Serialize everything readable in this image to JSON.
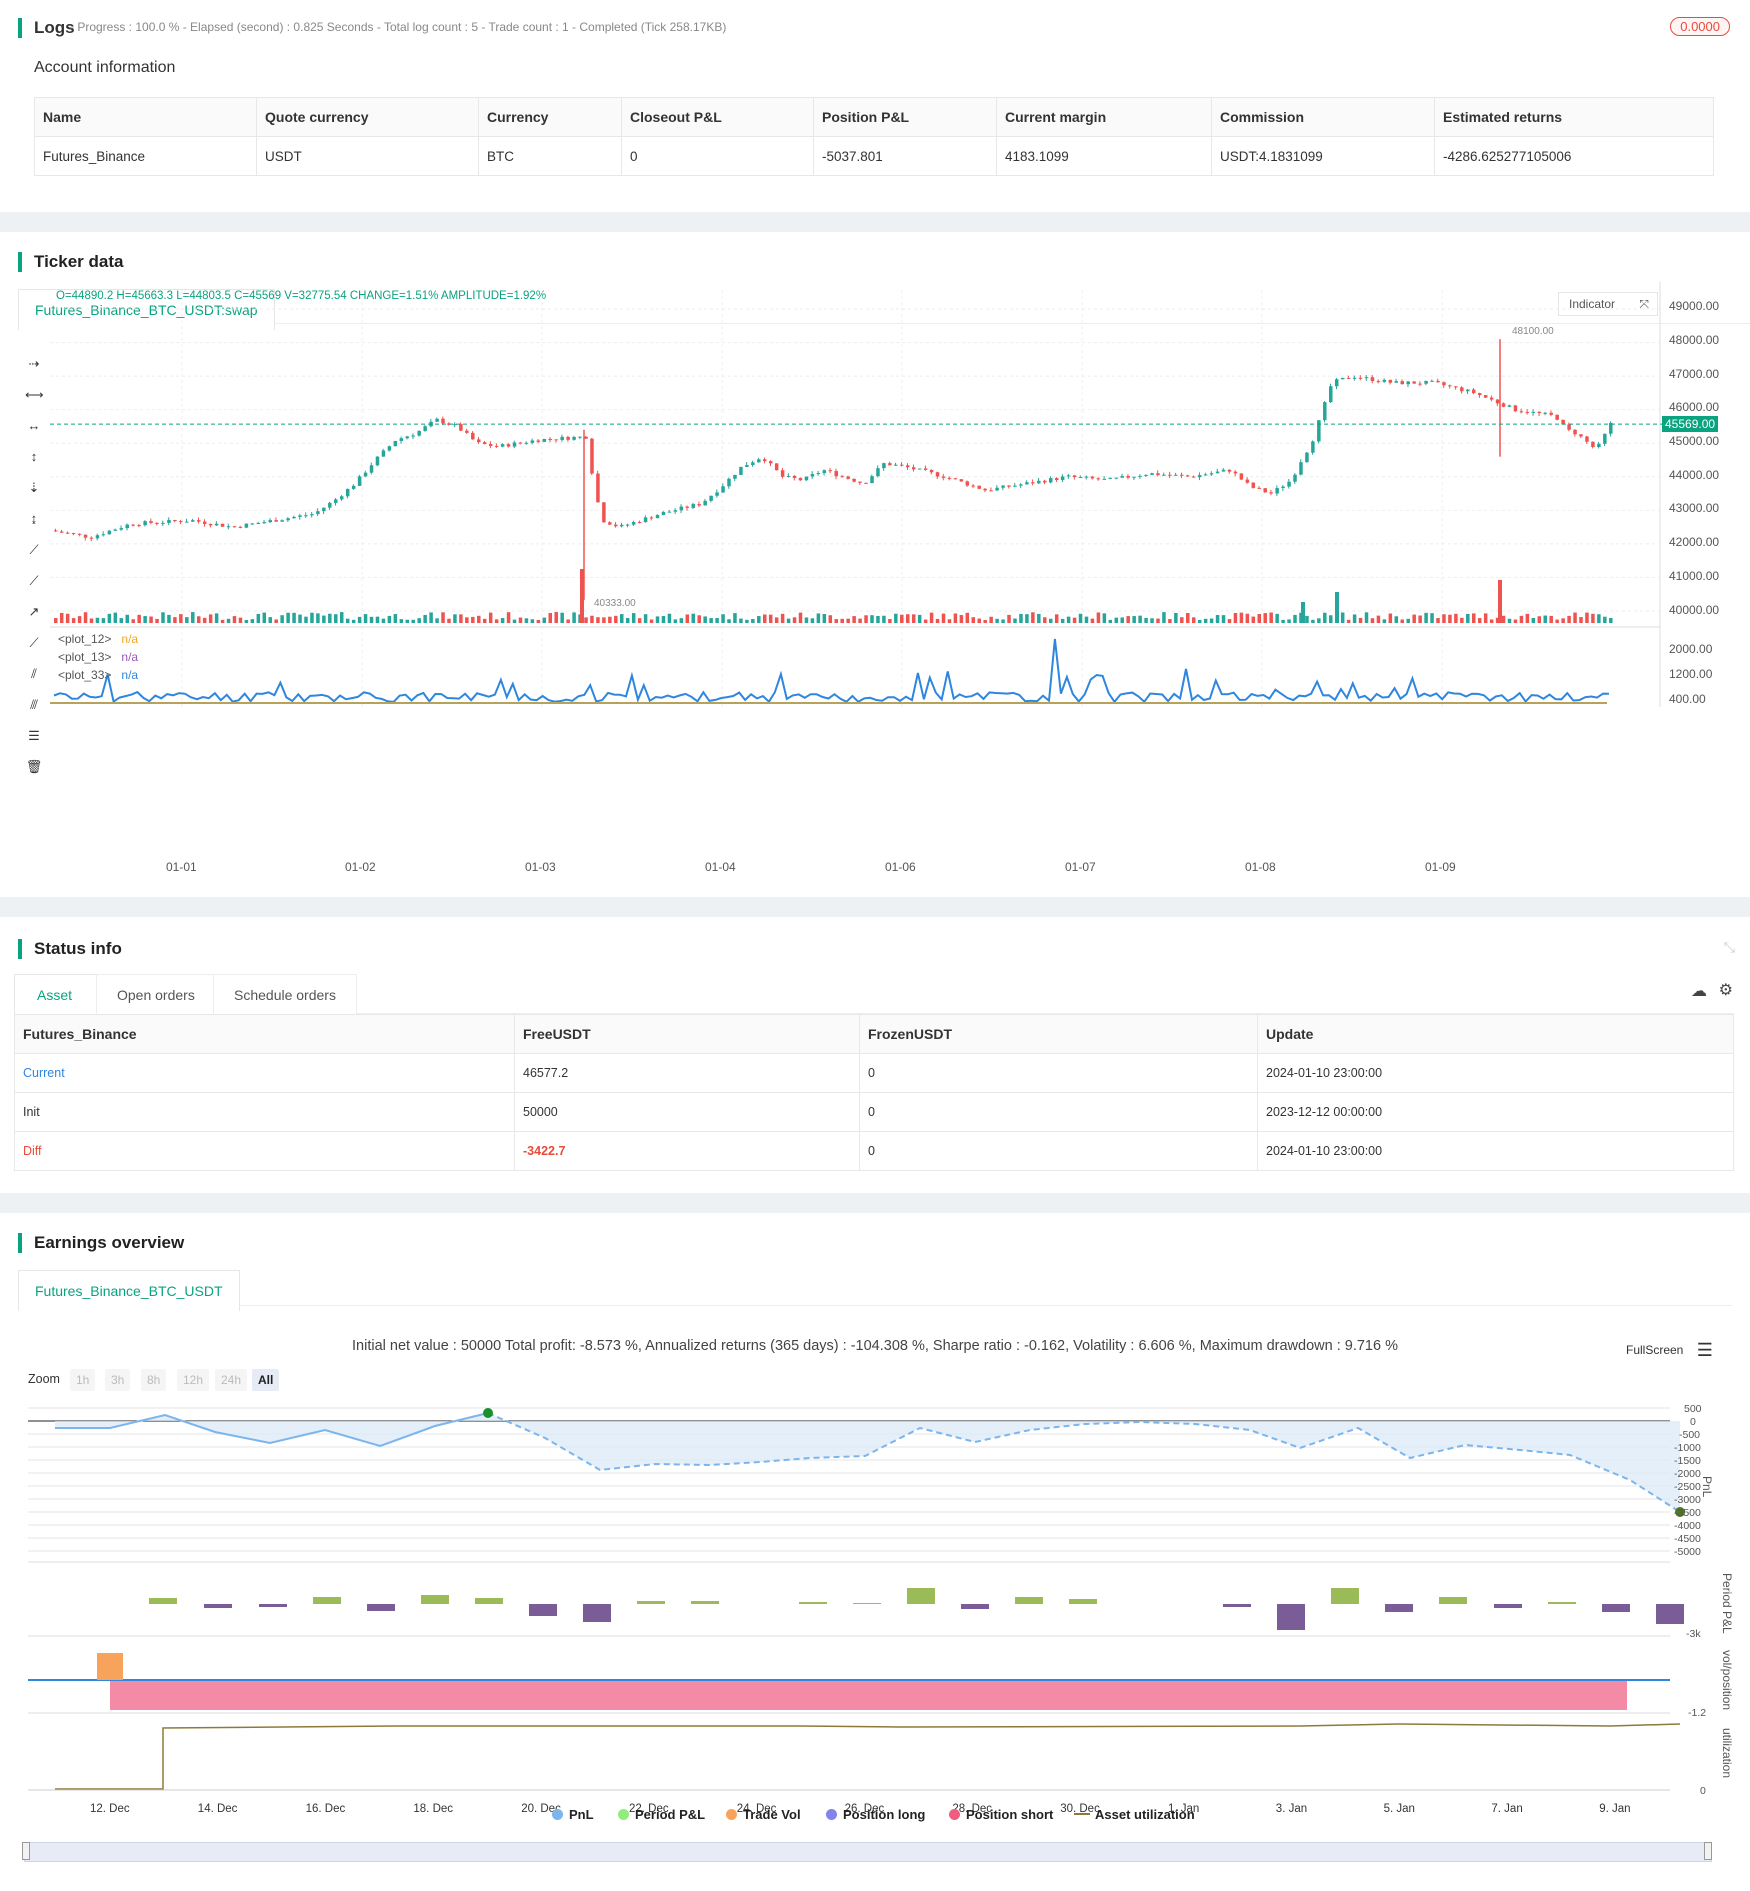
{
  "logs": {
    "title": "Logs",
    "status": "- Progress : 100.0 % - Elapsed (second) : 0.825  Seconds - Total log count : 5 - Trade count : 1 - Completed (Tick 258.17KB)",
    "badge": "0.0000"
  },
  "account": {
    "heading": "Account information",
    "columns": [
      "Name",
      "Quote currency",
      "Currency",
      "Closeout P&L",
      "Position P&L",
      "Current margin",
      "Commission",
      "Estimated returns"
    ],
    "row": [
      "Futures_Binance",
      "USDT",
      "BTC",
      "0",
      "-5037.801",
      "4183.1099",
      "USDT:4.1831099",
      "-4286.625277105006"
    ]
  },
  "ticker": {
    "title": "Ticker data",
    "tab": "Futures_Binance_BTC_USDT:swap",
    "ohlc": "O=44890.2 H=45663.3 L=44803.5 C=45569 V=32775.54 CHANGE=1.51% AMPLITUDE=1.92%",
    "indicator_button": "Indicator",
    "price_axis": [
      "49000.00",
      "48000.00",
      "47000.00",
      "46000.00",
      "45000.00",
      "44000.00",
      "43000.00",
      "42000.00",
      "41000.00",
      "40000.00"
    ],
    "current_price": "45569.00",
    "high_marker": "48100.00",
    "low_marker": "40333.00",
    "ind_axis": [
      "2000.00",
      "1200.00",
      "400.00"
    ],
    "plots": [
      {
        "name": "<plot_12>",
        "value": "n/a",
        "color": "#f5a623"
      },
      {
        "name": "<plot_13>",
        "value": "n/a",
        "color": "#9b59b6"
      },
      {
        "name": "<plot_33>",
        "value": "n/a",
        "color": "#2e86de"
      }
    ],
    "x_axis": [
      "01-01",
      "01-02",
      "01-03",
      "01-04",
      "01-06",
      "01-07",
      "01-08",
      "01-09"
    ]
  },
  "status": {
    "title": "Status info",
    "tabs": [
      "Asset",
      "Open orders",
      "Schedule orders"
    ],
    "columns": [
      "Futures_Binance",
      "FreeUSDT",
      "FrozenUSDT",
      "Update"
    ],
    "rows": [
      [
        "Current",
        "46577.2",
        "0",
        "2024-01-10 23:00:00"
      ],
      [
        "Init",
        "50000",
        "0",
        "2023-12-12 00:00:00"
      ],
      [
        "Diff",
        "-3422.7",
        "0",
        "2024-01-10 23:00:00"
      ]
    ]
  },
  "earnings": {
    "title": "Earnings overview",
    "tab": "Futures_Binance_BTC_USDT",
    "summary": "Initial net value : 50000 Total profit: -8.573 %, Annualized returns (365 days) : -104.308 %, Sharpe ratio : -0.162, Volatility : 6.606 %, Maximum drawdown : 9.716 %",
    "fullscreen": "FullScreen",
    "zoom_label": "Zoom",
    "zoom_buttons": [
      "1h",
      "3h",
      "8h",
      "12h",
      "24h",
      "All"
    ],
    "pnl_axis": [
      "500",
      "0",
      "-500",
      "-1000",
      "-1500",
      "-2000",
      "-2500",
      "-3000",
      "-3500",
      "-4000",
      "-4500",
      "-5000"
    ],
    "pnl_label": "PnL",
    "period_label": "Period P&L",
    "period_axis": "-3k",
    "vol_label": "vol/position",
    "vol_axis": "-1.2",
    "util_label": "utilization",
    "util_axis": "0",
    "x_axis": [
      "12. Dec",
      "14. Dec",
      "16. Dec",
      "18. Dec",
      "20. Dec",
      "22. Dec",
      "24. Dec",
      "26. Dec",
      "28. Dec",
      "30. Dec",
      "1. Jan",
      "3. Jan",
      "5. Jan",
      "7. Jan",
      "9. Jan"
    ],
    "legend": [
      {
        "label": "PnL",
        "color": "#7cb5ec"
      },
      {
        "label": "Period P&L",
        "color": "#90ed7d"
      },
      {
        "label": "Trade Vol",
        "color": "#f7a35c"
      },
      {
        "label": "Position long",
        "color": "#8085e9"
      },
      {
        "label": "Position short",
        "color": "#f15c80"
      },
      {
        "label": "Asset utilization",
        "color": "#8d7a3a"
      }
    ]
  }
}
